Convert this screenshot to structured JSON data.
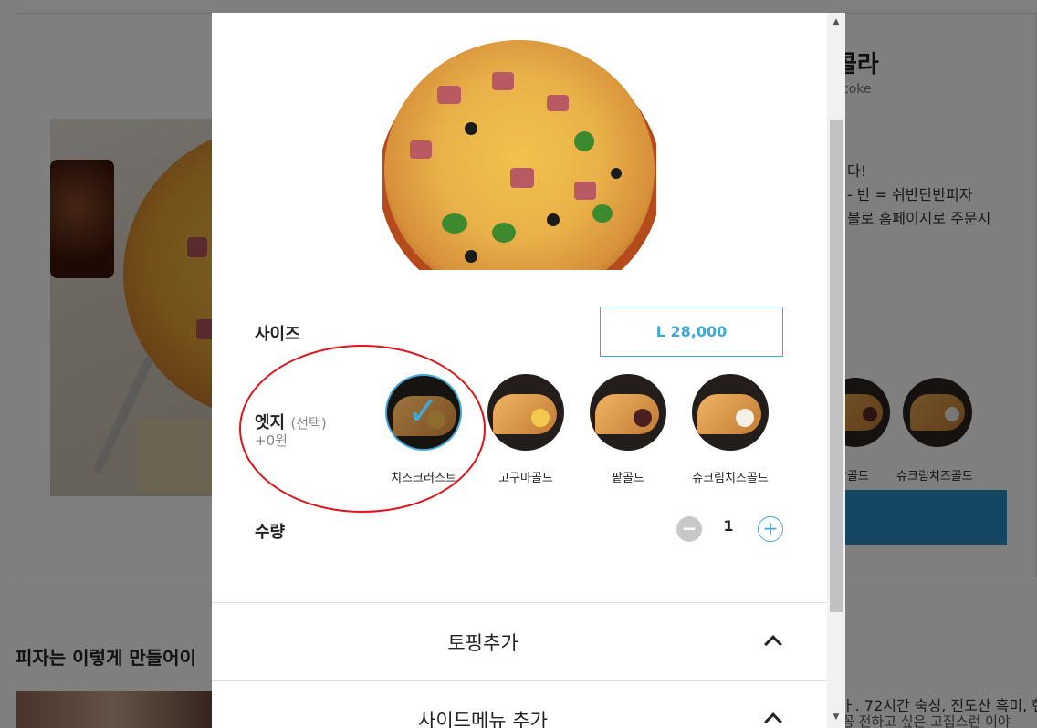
{
  "background": {
    "title": "콜라",
    "subtitle": "coke",
    "desc_lines": [
      "다!",
      "- 반 = 쉬반단반피자",
      "불로 홈페이지로 주문시"
    ],
    "edges": [
      {
        "label": "팥골드",
        "filling": "#5a2626"
      },
      {
        "label": "슈크림치즈골드",
        "filling": "#f3efe6"
      }
    ],
    "how_title": "피자는 이렇게 만들어이",
    "how_text": "ㅏ. 72시간 숙성, 진도산 흑미, 핸",
    "how_text2": "꽁 전하고 싶은 고집스런 이야"
  },
  "modal": {
    "size": {
      "label": "사이즈",
      "value": "L 28,000"
    },
    "edge": {
      "label": "엣지",
      "optional": "(선택)",
      "price": "+0원",
      "options": [
        {
          "label": "치즈크러스트",
          "filling": "#d9a647",
          "selected": true
        },
        {
          "label": "고구마골드",
          "filling": "#f2c94c",
          "selected": false
        },
        {
          "label": "팥골드",
          "filling": "#4d2020",
          "selected": false
        },
        {
          "label": "슈크림치즈골드",
          "filling": "#f4f0e6",
          "selected": false
        }
      ]
    },
    "quantity": {
      "label": "수량",
      "value": "1",
      "minus": "−",
      "plus": "+"
    },
    "sections": [
      {
        "title": "토핑추가"
      },
      {
        "title": "사이드메뉴 추가"
      }
    ]
  },
  "colors": {
    "accent": "#3fa9d6",
    "annotation": "#e0141b"
  }
}
